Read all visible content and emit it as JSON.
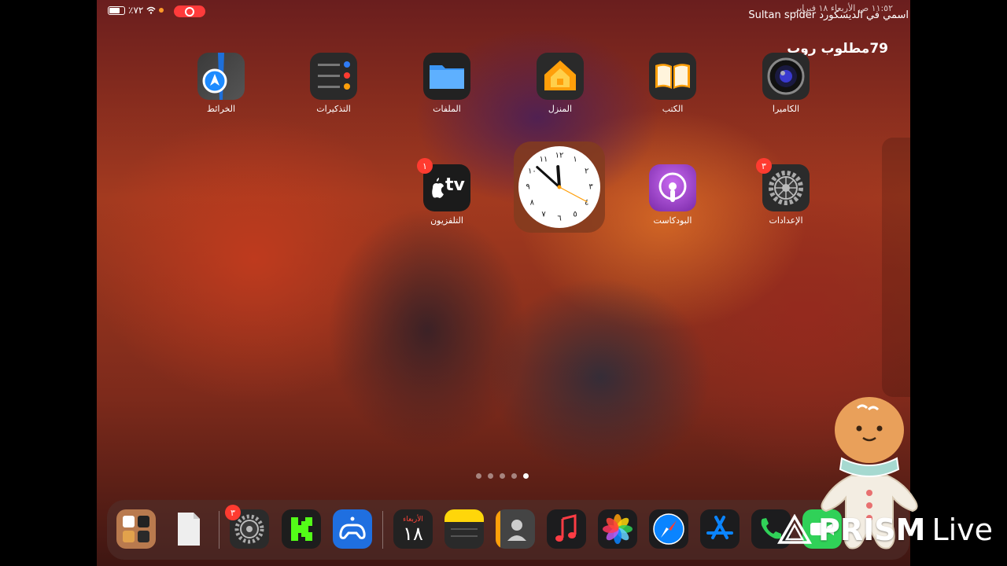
{
  "status_bar": {
    "battery_percent": "٪٧٢",
    "datetime_and_caption": "اسمي في الديسكورد Sultan spider",
    "time_overlay": "١١:٥٢ ص الأربعاء ١٨ فبراير"
  },
  "overlay_caption": "79مطلوب روب",
  "apps_row1": [
    {
      "name": "maps",
      "label": "الخرائط"
    },
    {
      "name": "reminders",
      "label": "التذكيرات"
    },
    {
      "name": "files",
      "label": "الملفات"
    },
    {
      "name": "home",
      "label": "المنزل"
    },
    {
      "name": "books",
      "label": "الكتب"
    },
    {
      "name": "camera",
      "label": "الكاميرا"
    }
  ],
  "apps_row2": [
    {
      "name": "tv",
      "label": "التلفزيون",
      "badge": "١"
    },
    {
      "name": "podcasts",
      "label": "البودكاست"
    },
    {
      "name": "settings",
      "label": "الإعدادات",
      "badge": "٣"
    }
  ],
  "clock_numerals": [
    "١٢",
    "١",
    "٢",
    "٣",
    "٤",
    "٥",
    "٦",
    "٧",
    "٨",
    "٩",
    "١٠",
    "١١"
  ],
  "tv_text": "tv",
  "page_dots": {
    "count": 5,
    "active": 4
  },
  "dock": {
    "settings_badge": "٣",
    "calendar_day_name": "الأربعاء",
    "calendar_day_number": "١٨"
  },
  "watermark": {
    "brand": "PRISM",
    "word2": "Live"
  },
  "colors": {
    "accent_red": "#ff3b30",
    "recording": "#ff3b3b"
  }
}
